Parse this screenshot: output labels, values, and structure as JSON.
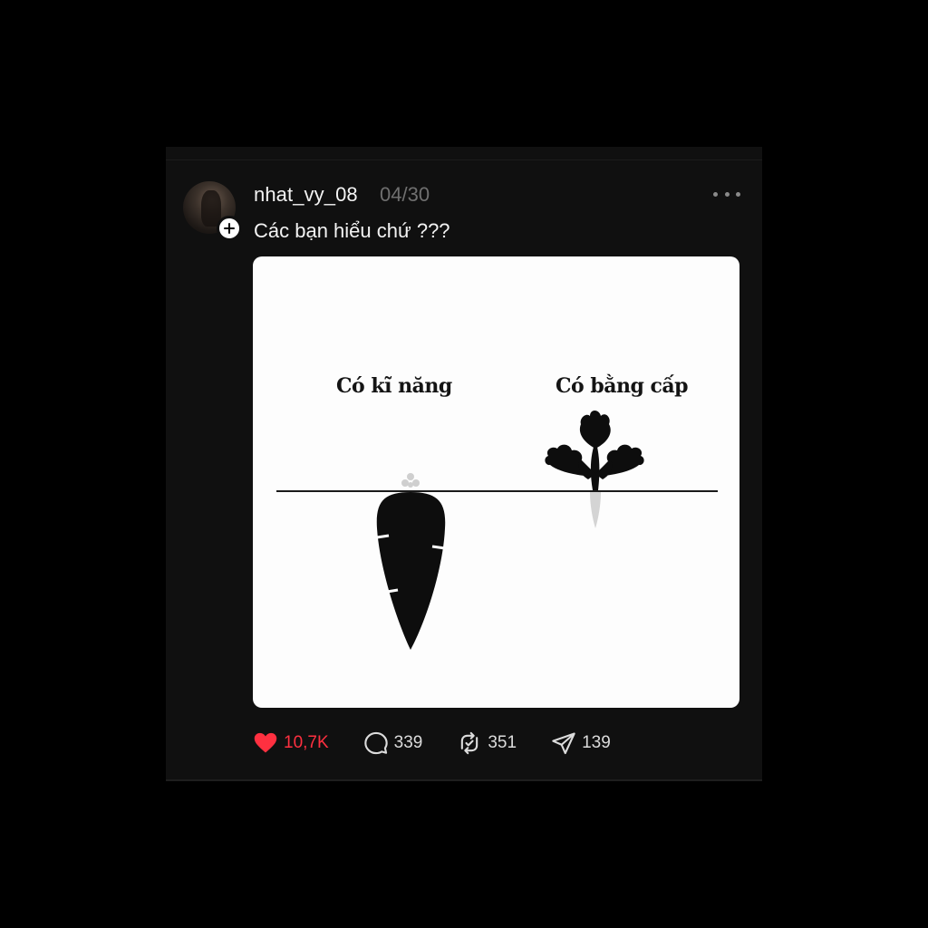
{
  "post": {
    "username": "nhat_vy_08",
    "date": "04/30",
    "caption": "Các bạn hiểu chứ ???",
    "image": {
      "left_label": "Có kĩ năng",
      "right_label": "Có bằng cấp"
    }
  },
  "actions": {
    "likes": "10,7K",
    "comments": "339",
    "reposts": "351",
    "shares": "139"
  },
  "colors": {
    "background": "#000000",
    "card": "#101010",
    "like_active": "#ff3040",
    "muted": "#6f6f6f"
  },
  "icons": [
    "plus-icon",
    "more-icon",
    "heart-icon",
    "comment-icon",
    "repost-icon",
    "share-icon"
  ]
}
